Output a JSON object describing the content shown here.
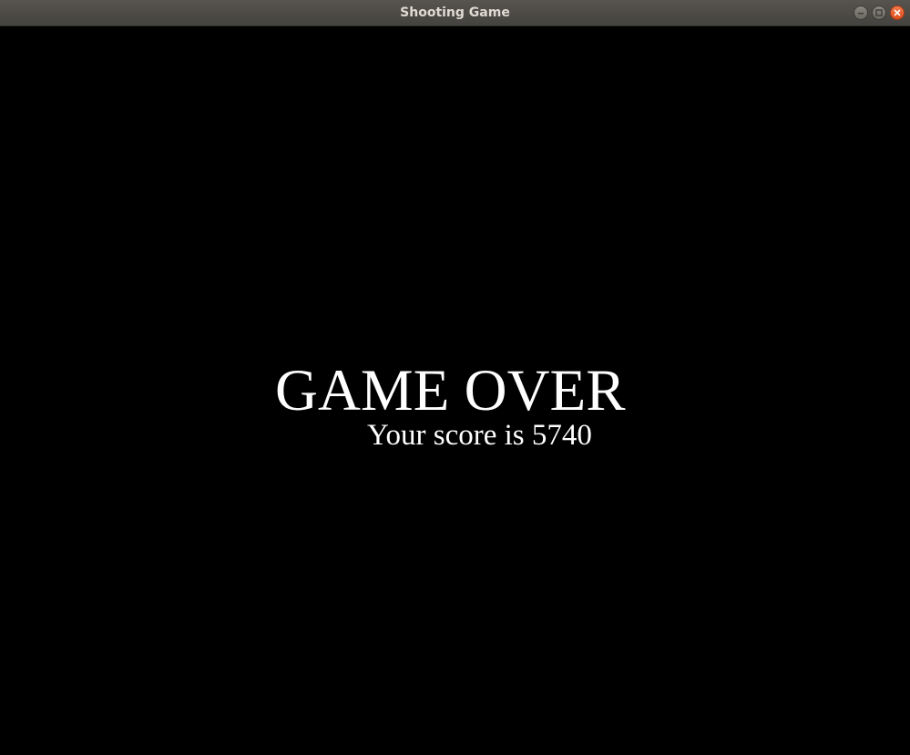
{
  "window": {
    "title": "Shooting Game",
    "controls": {
      "minimize_icon": "minimize-icon",
      "maximize_icon": "maximize-icon",
      "close_icon": "close-icon"
    }
  },
  "game": {
    "game_over_text": "GAME OVER",
    "score_text": "Your score is 5740",
    "background_color": "#000000",
    "text_color": "#ffffff"
  }
}
